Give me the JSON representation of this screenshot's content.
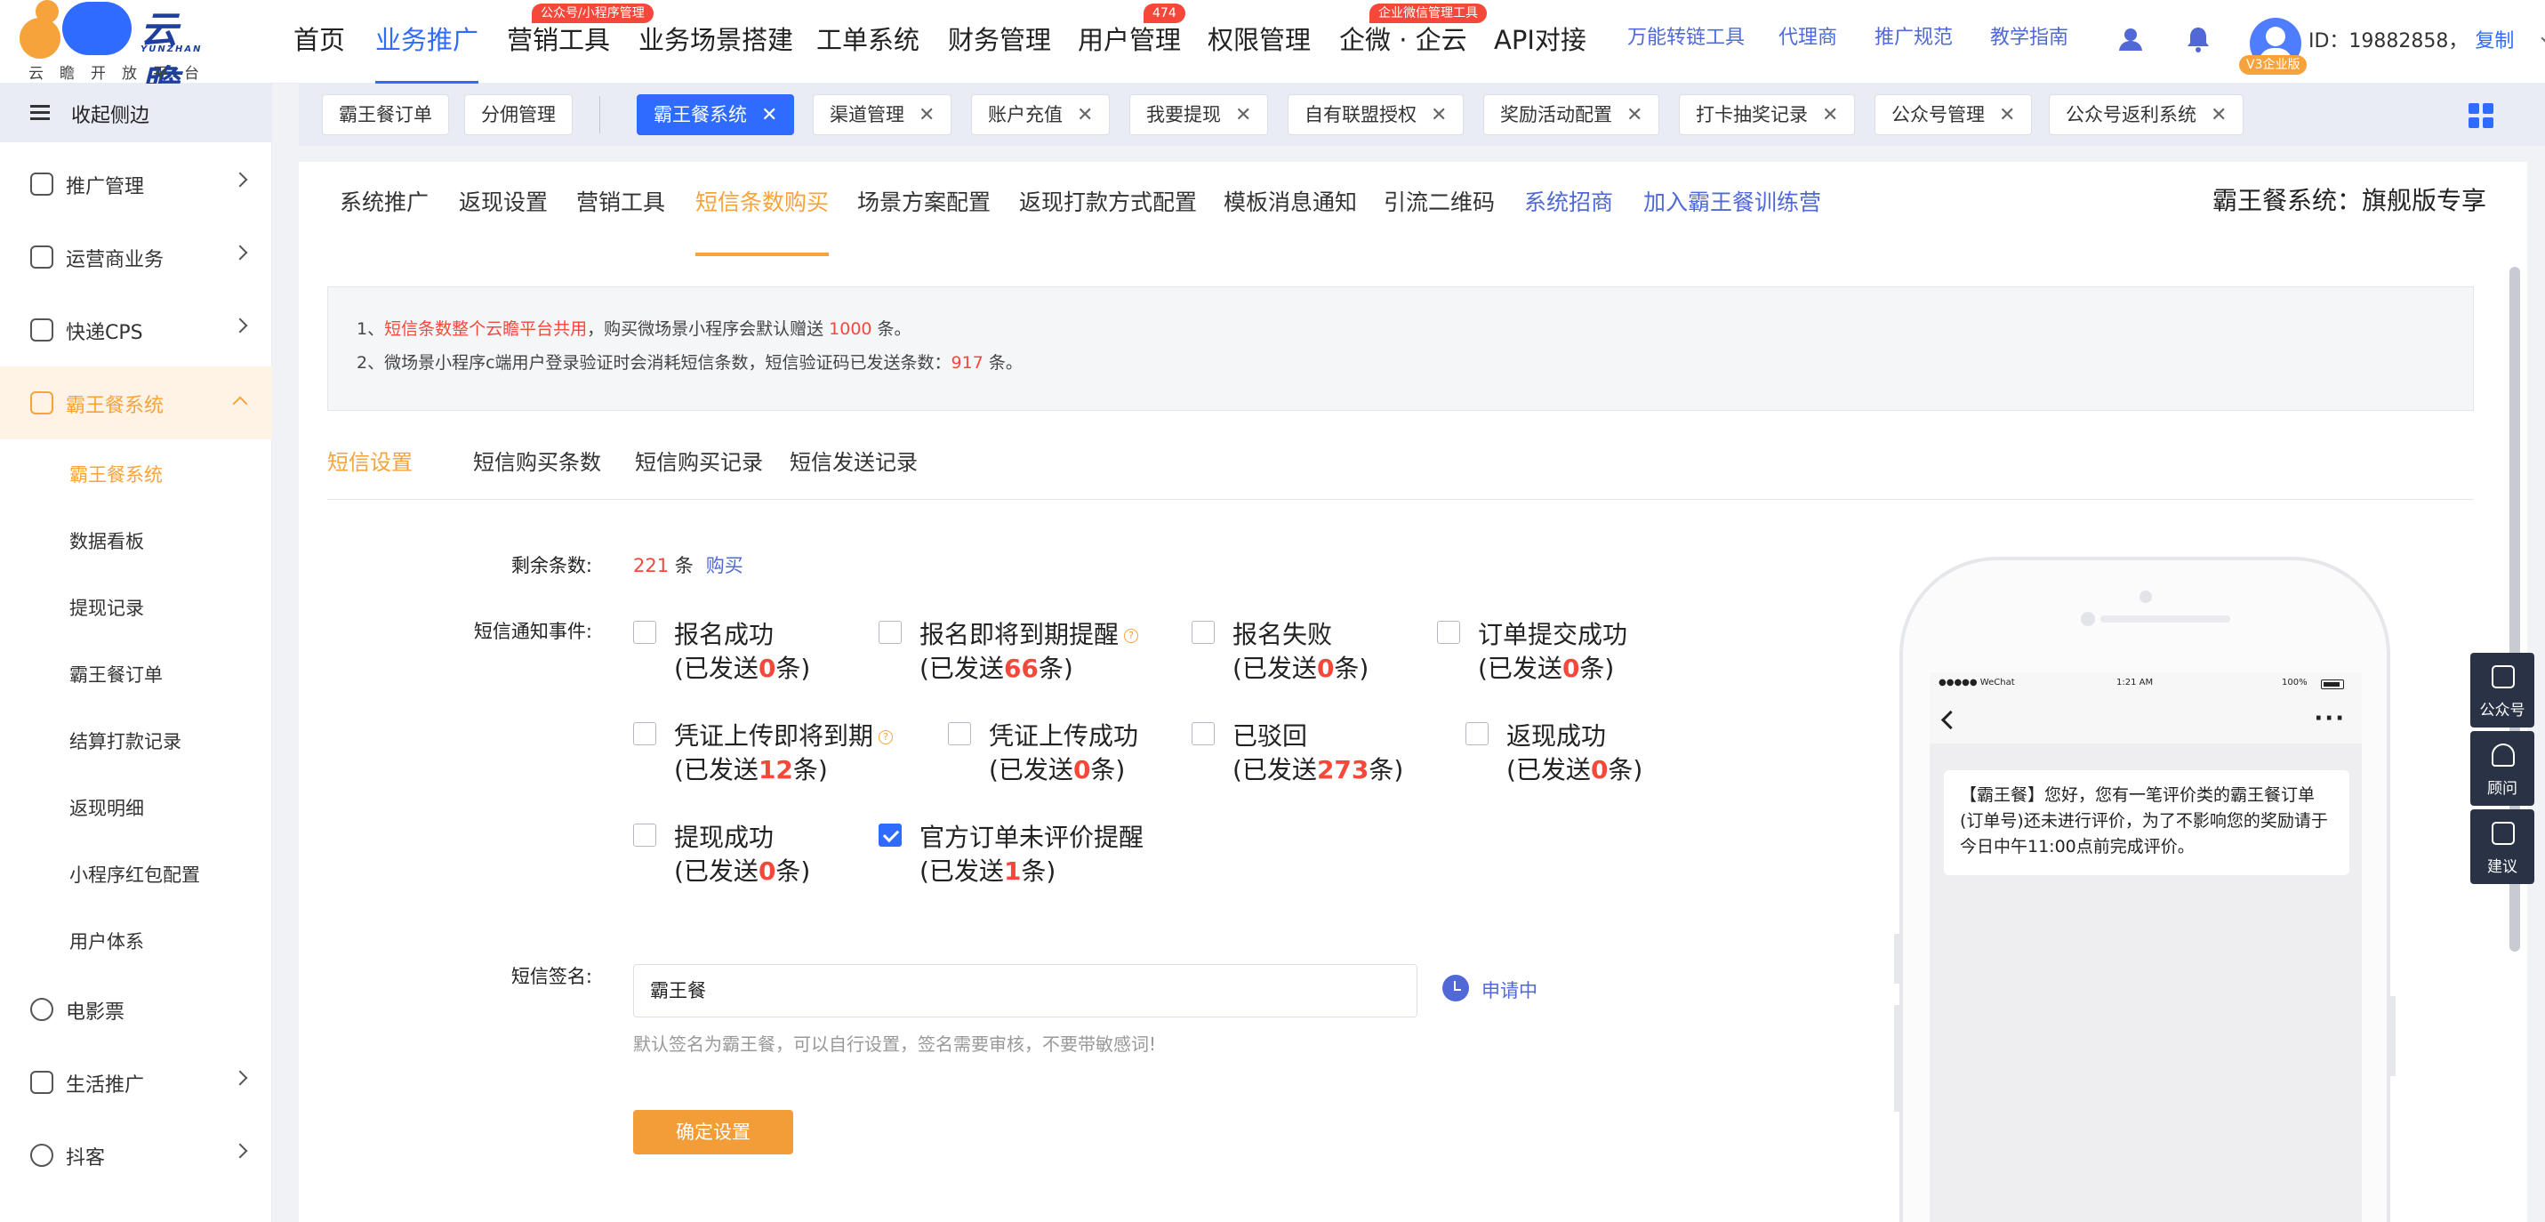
{
  "logo": {
    "name": "云瞻",
    "sub": "YUNZHAN",
    "tagline": "云瞻开放平台"
  },
  "mainnav": [
    {
      "label": "首页"
    },
    {
      "label": "业务推广"
    },
    {
      "label": "营销工具",
      "badge": "公众号/小程序管理"
    },
    {
      "label": "业务场景搭建"
    },
    {
      "label": "工单系统"
    },
    {
      "label": "财务管理"
    },
    {
      "label": "用户管理",
      "badge": "474"
    },
    {
      "label": "权限管理"
    },
    {
      "label": "企微 · 企云",
      "badge": "企业微信管理工具"
    },
    {
      "label": "API对接"
    }
  ],
  "subnav": [
    "万能转链工具",
    "代理商",
    "推广规范",
    "教学指南"
  ],
  "user": {
    "id_text": "ID：19882858，",
    "copy": "复制",
    "level": "V3企业版"
  },
  "sidebar": {
    "collapse": "收起侧边",
    "menus": [
      {
        "label": "推广管理"
      },
      {
        "label": "运营商业务"
      },
      {
        "label": "快递CPS"
      },
      {
        "label": "霸王餐系统"
      }
    ],
    "submenus": [
      "霸王餐系统",
      "数据看板",
      "提现记录",
      "霸王餐订单",
      "结算打款记录",
      "返现明细",
      "小程序红包配置",
      "用户体系"
    ],
    "menus2": [
      {
        "label": "电影票"
      },
      {
        "label": "生活推广"
      },
      {
        "label": "抖客"
      }
    ]
  },
  "pagetabs": [
    {
      "label": "霸王餐订单"
    },
    {
      "label": "分佣管理"
    },
    {
      "label": "霸王餐系统"
    },
    {
      "label": "渠道管理"
    },
    {
      "label": "账户充值"
    },
    {
      "label": "我要提现"
    },
    {
      "label": "自有联盟授权"
    },
    {
      "label": "奖励活动配置"
    },
    {
      "label": "打卡抽奖记录"
    },
    {
      "label": "公众号管理"
    },
    {
      "label": "公众号返利系统"
    }
  ],
  "contenttabs": [
    "系统推广",
    "返现设置",
    "营销工具",
    "短信条数购买",
    "场景方案配置",
    "返现打款方式配置",
    "模板消息通知",
    "引流二维码",
    "系统招商",
    "加入霸王餐训练营"
  ],
  "right_title": "霸王餐系统：旗舰版专享",
  "notice": {
    "l1_a": "1、",
    "l1_red": "短信条数整个云瞻平台共用",
    "l1_b": "，购买微场景小程序会默认赠送 ",
    "l1_num": "1000",
    "l1_c": " 条。",
    "l2_a": "2、微场景小程序c端用户登录验证时会消耗短信条数，短信验证码已发送条数：",
    "l2_num": "917",
    "l2_c": " 条。"
  },
  "innertabs": [
    "短信设置",
    "短信购买条数",
    "短信购买记录",
    "短信发送记录"
  ],
  "form": {
    "remain_label": "剩余条数:",
    "remain_num": "221",
    "remain_unit": " 条",
    "buy": "购买",
    "notify_label": "短信通知事件:",
    "events": [
      {
        "title": "报名成功",
        "pre": "(已发送",
        "count": "0",
        "post": "条)",
        "checked": false,
        "help": false
      },
      {
        "title": "报名即将到期提醒",
        "pre": "(已发送",
        "count": "66",
        "post": "条)",
        "checked": false,
        "help": true
      },
      {
        "title": "报名失败",
        "pre": "(已发送",
        "count": "0",
        "post": "条)",
        "checked": false,
        "help": false
      },
      {
        "title": "订单提交成功",
        "pre": "(已发送",
        "count": "0",
        "post": "条)",
        "checked": false,
        "help": false
      },
      {
        "title": "凭证上传即将到期",
        "pre": "(已发送",
        "count": "12",
        "post": "条)",
        "checked": false,
        "help": true
      },
      {
        "title": "凭证上传成功",
        "pre": "(已发送",
        "count": "0",
        "post": "条)",
        "checked": false,
        "help": false
      },
      {
        "title": "已驳回",
        "pre": "(已发送",
        "count": "273",
        "post": "条)",
        "checked": false,
        "help": false
      },
      {
        "title": "返现成功",
        "pre": "(已发送",
        "count": "0",
        "post": "条)",
        "checked": false,
        "help": false
      },
      {
        "title": "提现成功",
        "pre": "(已发送",
        "count": "0",
        "post": "条)",
        "checked": false,
        "help": false
      },
      {
        "title": "官方订单未评价提醒",
        "pre": "(已发送",
        "count": "1",
        "post": "条)",
        "checked": true,
        "help": false
      }
    ],
    "sign_label": "短信签名:",
    "sign_value": "霸王餐",
    "sign_status": "申请中",
    "hint": "默认签名为霸王餐，可以自行设置，签名需要审核，不要带敏感词!",
    "confirm": "确定设置"
  },
  "phone": {
    "signal": "●●●●● WeChat",
    "time": "1:21 AM",
    "battery": "100%",
    "message": "【霸王餐】您好，您有一笔评价类的霸王餐订单(订单号)还未进行评价，为了不影响您的奖励请于今日中午11:00点前完成评价。"
  },
  "floatbar": [
    "公众号",
    "顾问",
    "建议"
  ],
  "colors": {
    "accent_blue": "#2f6bff",
    "accent_orange": "#f7a33c",
    "red": "#f5483b"
  }
}
